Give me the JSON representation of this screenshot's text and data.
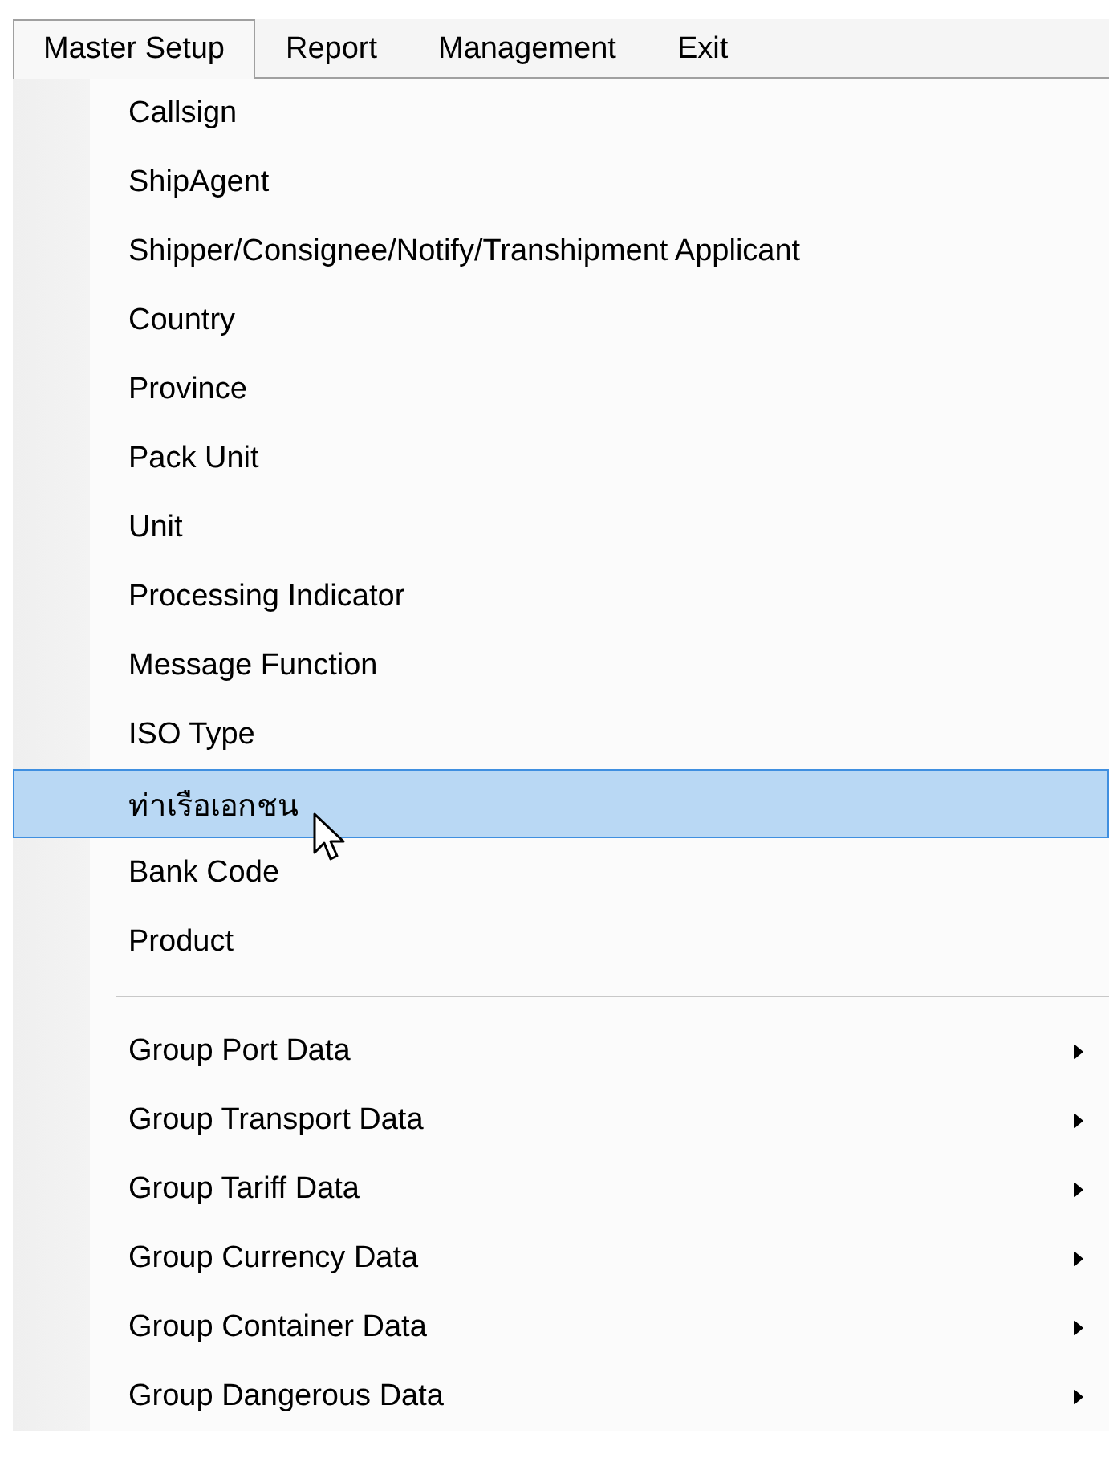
{
  "menu_bar": [
    {
      "label": "Master Setup",
      "selected": true
    },
    {
      "label": "Report",
      "selected": false
    },
    {
      "label": "Management",
      "selected": false
    },
    {
      "label": "Exit",
      "selected": false
    }
  ],
  "dropdown": [
    {
      "kind": "item",
      "label": "Callsign",
      "selected": false
    },
    {
      "kind": "item",
      "label": "ShipAgent",
      "selected": false
    },
    {
      "kind": "item",
      "label": "Shipper/Consignee/Notify/Transhipment Applicant",
      "selected": false
    },
    {
      "kind": "item",
      "label": "Country",
      "selected": false
    },
    {
      "kind": "item",
      "label": "Province",
      "selected": false
    },
    {
      "kind": "item",
      "label": "Pack Unit",
      "selected": false
    },
    {
      "kind": "item",
      "label": "Unit",
      "selected": false
    },
    {
      "kind": "item",
      "label": "Processing Indicator",
      "selected": false
    },
    {
      "kind": "item",
      "label": "Message Function",
      "selected": false
    },
    {
      "kind": "item",
      "label": "ISO Type",
      "selected": false
    },
    {
      "kind": "item",
      "label": "ท่าเรือเอกชน",
      "selected": true
    },
    {
      "kind": "item",
      "label": "Bank Code",
      "selected": false
    },
    {
      "kind": "item",
      "label": "Product",
      "selected": false
    },
    {
      "kind": "separator"
    },
    {
      "kind": "submenu",
      "label": "Group Port Data",
      "selected": false
    },
    {
      "kind": "submenu",
      "label": "Group Transport Data",
      "selected": false
    },
    {
      "kind": "submenu",
      "label": "Group Tariff Data",
      "selected": false
    },
    {
      "kind": "submenu",
      "label": "Group Currency Data",
      "selected": false
    },
    {
      "kind": "submenu",
      "label": "Group Container Data",
      "selected": false
    },
    {
      "kind": "submenu",
      "label": "Group Dangerous Data",
      "selected": false
    }
  ]
}
